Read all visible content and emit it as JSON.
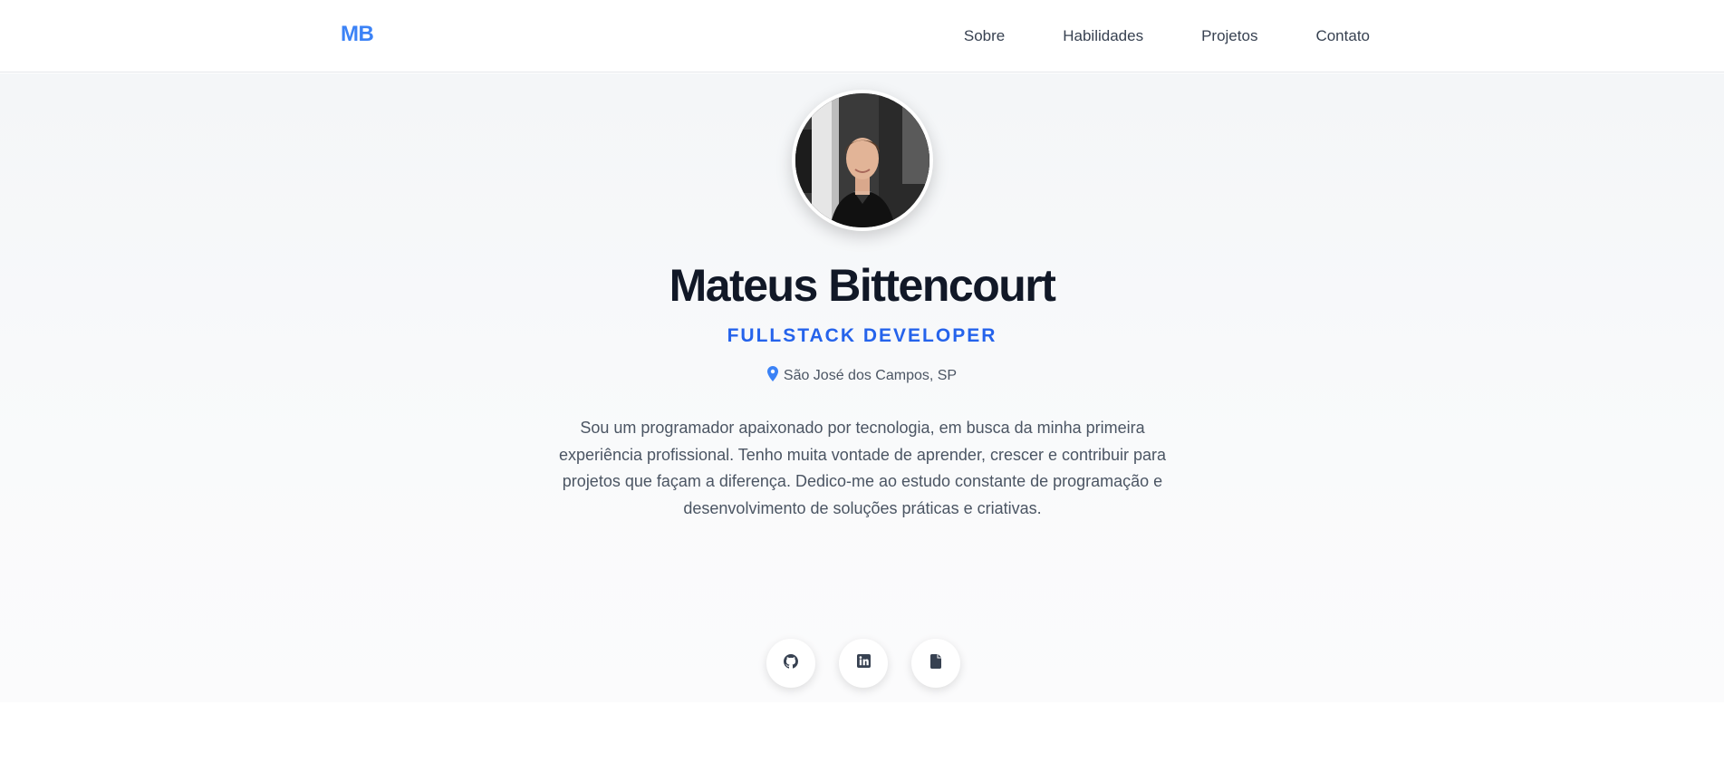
{
  "nav": {
    "logo": "MB",
    "links": [
      "Sobre",
      "Habilidades",
      "Projetos",
      "Contato"
    ]
  },
  "hero": {
    "name": "Mateus Bittencourt",
    "role": "FULLSTACK DEVELOPER",
    "location": "São José dos Campos, SP",
    "bio": "Sou um programador apaixonado por tecnologia, em busca da minha primeira experiência profissional. Tenho muita vontade de aprender, crescer e contribuir para projetos que façam a diferença. Dedico-me ao estudo constante de programação e desenvolvimento de soluções práticas e criativas.",
    "socials": [
      {
        "icon": "github-icon"
      },
      {
        "icon": "linkedin-icon"
      },
      {
        "icon": "document-icon"
      }
    ]
  },
  "colors": {
    "accent": "#3b82f6",
    "role": "#2563eb",
    "heading": "#111827",
    "text": "#4b5563"
  }
}
